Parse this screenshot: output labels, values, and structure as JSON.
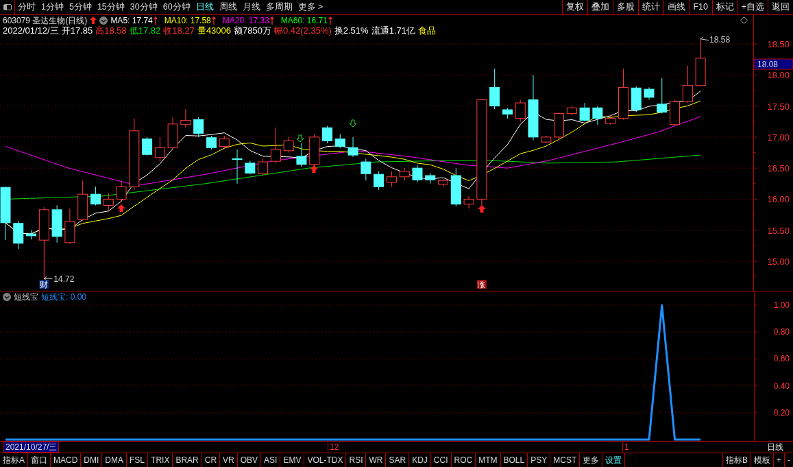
{
  "toolbar": {
    "periods": [
      {
        "label": "分时",
        "selected": false
      },
      {
        "label": "1分钟",
        "selected": false
      },
      {
        "label": "5分钟",
        "selected": false
      },
      {
        "label": "15分钟",
        "selected": false
      },
      {
        "label": "30分钟",
        "selected": false
      },
      {
        "label": "60分钟",
        "selected": false
      },
      {
        "label": "日线",
        "selected": true
      },
      {
        "label": "周线",
        "selected": false
      },
      {
        "label": "月线",
        "selected": false
      },
      {
        "label": "多周期",
        "selected": false
      },
      {
        "label": "更多 >",
        "selected": false
      }
    ],
    "actions": [
      "复权",
      "叠加",
      "多股",
      "统计",
      "画线",
      "F10",
      "标记",
      "+自选",
      "返回"
    ]
  },
  "main_chart": {
    "title": "603079 圣达生物(日线)",
    "moving_averages": [
      {
        "label": "MA5: 17.74",
        "color": "#ffffff",
        "rising": true
      },
      {
        "label": "MA10: 17.58",
        "color": "#ffff00",
        "rising": true
      },
      {
        "label": "MA20: 17.33",
        "color": "#ff00ff",
        "rising": true
      },
      {
        "label": "MA60: 16.71",
        "color": "#00ff00",
        "rising": true
      }
    ],
    "quote": [
      {
        "text": "2022/01/12/三",
        "color": "#ffffff"
      },
      {
        "text": "开17.85",
        "color": "#ffffff"
      },
      {
        "text": "高18.58",
        "color": "#ff3232"
      },
      {
        "text": "低17.82",
        "color": "#00e000"
      },
      {
        "text": "收18.27",
        "color": "#ff3232"
      },
      {
        "text": "量43006",
        "color": "#ffff00"
      },
      {
        "text": "额7850万",
        "color": "#ffffff"
      },
      {
        "text": "幅0.42(2.35%)",
        "color": "#ff3232"
      },
      {
        "text": "换2.51%",
        "color": "#ffffff"
      },
      {
        "text": "流通1.71亿",
        "color": "#ffffff"
      },
      {
        "text": "食品",
        "color": "#ffff00"
      }
    ],
    "high_label": "18.58",
    "low_label": "14.72",
    "finance_marker": "财",
    "limit_up_marker": "涨",
    "current_price": "18.08",
    "price_ticks": [
      "18.50",
      "18.00",
      "17.50",
      "17.00",
      "16.50",
      "16.00",
      "15.50",
      "15.00"
    ]
  },
  "indicator": {
    "value_label": "短线宝: 0.00",
    "chart_data": {
      "type": "line",
      "grid": true,
      "ylim": [
        0,
        1.1
      ],
      "yticks": [
        {
          "value": 1,
          "label": "1.00"
        },
        {
          "value": 0.8,
          "label": "0.80"
        },
        {
          "value": 0.6,
          "label": "0.60"
        },
        {
          "value": 0.4,
          "label": "0.40"
        },
        {
          "value": 0.2,
          "label": "0.20"
        }
      ],
      "series": [
        {
          "name": "短线宝",
          "color": "#1e8fff",
          "values": [
            0,
            0,
            0,
            0,
            0,
            0,
            0,
            0,
            0,
            0,
            0,
            0,
            0,
            0,
            0,
            0,
            0,
            0,
            0,
            0,
            0,
            0,
            0,
            0,
            0,
            0,
            0,
            0,
            0,
            0,
            0,
            0,
            0,
            0,
            0,
            0,
            0,
            0,
            0,
            0,
            0,
            0,
            0,
            0,
            0,
            0,
            0,
            0,
            0,
            0,
            0,
            1,
            0,
            0,
            0
          ]
        }
      ]
    }
  },
  "timeline": {
    "start_date": "2021/10/27/三",
    "month_labels": [
      "12",
      "1"
    ],
    "period": "日线"
  },
  "bottom_tabs": [
    {
      "label": "指标A",
      "kind": "tab"
    },
    {
      "label": "窗口",
      "kind": "tab"
    },
    {
      "label": "MACD",
      "kind": "tab"
    },
    {
      "label": "DMI",
      "kind": "tab"
    },
    {
      "label": "DMA",
      "kind": "tab"
    },
    {
      "label": "FSL",
      "kind": "tab"
    },
    {
      "label": "TRIX",
      "kind": "tab"
    },
    {
      "label": "BRAR",
      "kind": "tab"
    },
    {
      "label": "CR",
      "kind": "tab"
    },
    {
      "label": "VR",
      "kind": "tab"
    },
    {
      "label": "OBV",
      "kind": "tab"
    },
    {
      "label": "ASI",
      "kind": "tab"
    },
    {
      "label": "EMV",
      "kind": "tab"
    },
    {
      "label": "VOL-TDX",
      "kind": "tab"
    },
    {
      "label": "RSI",
      "kind": "tab"
    },
    {
      "label": "WR",
      "kind": "tab"
    },
    {
      "label": "SAR",
      "kind": "tab"
    },
    {
      "label": "KDJ",
      "kind": "tab"
    },
    {
      "label": "CCI",
      "kind": "tab"
    },
    {
      "label": "ROC",
      "kind": "tab"
    },
    {
      "label": "MTM",
      "kind": "tab"
    },
    {
      "label": "BOLL",
      "kind": "tab"
    },
    {
      "label": "PSY",
      "kind": "tab"
    },
    {
      "label": "MCST",
      "kind": "tab"
    },
    {
      "label": "更多",
      "kind": "tab"
    },
    {
      "label": "设置",
      "kind": "settings"
    }
  ],
  "bottom_right_tabs": [
    "指标B",
    "模板",
    "+",
    "-"
  ]
}
